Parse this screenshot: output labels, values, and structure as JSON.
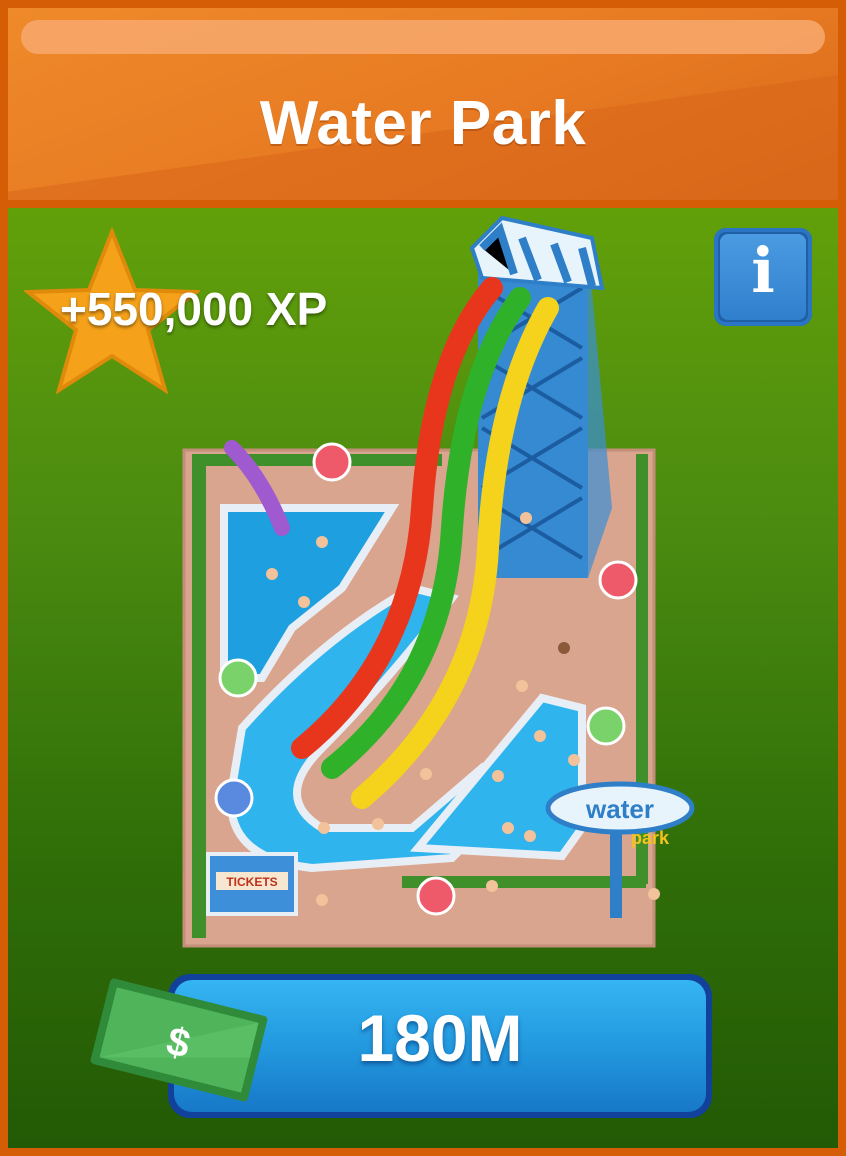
{
  "header": {
    "title": "Water Park"
  },
  "reward": {
    "xp_label": "+550,000 XP"
  },
  "info_button": {
    "glyph": "i"
  },
  "purchase": {
    "price_label": "180M",
    "currency_icon": "dollar-bill-icon",
    "currency_symbol": "$"
  },
  "illustration": {
    "sign_text": "water",
    "sign_subtext": "park",
    "booth_sign": "TICKETS"
  },
  "colors": {
    "frame": "#d45d05",
    "header": "#e77a22",
    "body_top": "#62a00a",
    "body_bottom": "#235a05",
    "button": "#2196dd",
    "star": "#f5a21a"
  }
}
